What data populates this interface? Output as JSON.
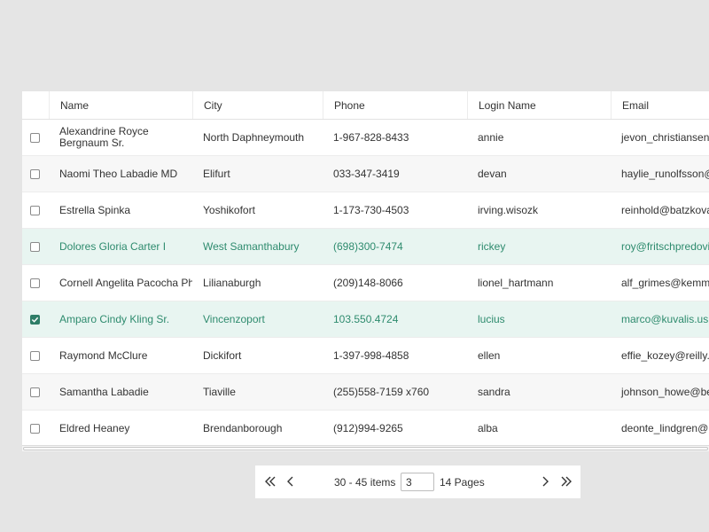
{
  "columns": [
    "Name",
    "City",
    "Phone",
    "Login Name",
    "Email"
  ],
  "rows": [
    {
      "name": "Alexandrine Royce Bergnaum Sr.",
      "city": "North Daphneymouth",
      "phone": "1-967-828-8433",
      "login": "annie",
      "email": "jevon_christiansen@",
      "checked": false,
      "highlight": false
    },
    {
      "name": "Naomi Theo Labadie MD",
      "city": "Elifurt",
      "phone": "033-347-3419",
      "login": "devan",
      "email": "haylie_runolfsson@",
      "checked": false,
      "highlight": false
    },
    {
      "name": "Estrella Spinka",
      "city": "Yoshikofort",
      "phone": "1-173-730-4503",
      "login": "irving.wisozk",
      "email": "reinhold@batzkova",
      "checked": false,
      "highlight": false
    },
    {
      "name": "Dolores Gloria Carter I",
      "city": "West Samanthabury",
      "phone": "(698)300-7474",
      "login": "rickey",
      "email": "roy@fritschpredovic",
      "checked": false,
      "highlight": true
    },
    {
      "name": "Cornell Angelita Pacocha PhD",
      "city": "Lilianaburgh",
      "phone": "(209)148-8066",
      "login": "lionel_hartmann",
      "email": "alf_grimes@kemme",
      "checked": false,
      "highlight": false
    },
    {
      "name": "Amparo Cindy Kling Sr.",
      "city": "Vincenzoport",
      "phone": "103.550.4724",
      "login": "lucius",
      "email": "marco@kuvalis.us",
      "checked": true,
      "highlight": true
    },
    {
      "name": "Raymond McClure",
      "city": "Dickifort",
      "phone": "1-397-998-4858",
      "login": "ellen",
      "email": "effie_kozey@reilly.i",
      "checked": false,
      "highlight": false
    },
    {
      "name": "Samantha Labadie",
      "city": "Tiaville",
      "phone": "(255)558-7159 x760",
      "login": "sandra",
      "email": "johnson_howe@be",
      "checked": false,
      "highlight": false
    },
    {
      "name": "Eldred Heaney",
      "city": "Brendanborough",
      "phone": "(912)994-9265",
      "login": "alba",
      "email": "deonte_lindgren@",
      "checked": false,
      "highlight": false
    }
  ],
  "pager": {
    "info": "30 - 45 items",
    "page_value": "3",
    "total_pages": "14 Pages"
  },
  "colors": {
    "accent": "#2e7d67",
    "highlight_bg": "#e8f5f1"
  },
  "icons": {
    "first": "double-chevron-left-icon",
    "prev": "chevron-left-icon",
    "next": "chevron-right-icon",
    "last": "double-chevron-right-icon"
  }
}
